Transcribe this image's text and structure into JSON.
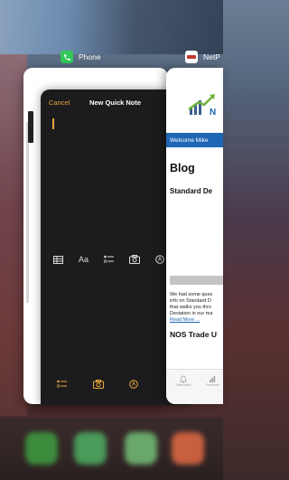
{
  "apps": [
    {
      "name": "Phone",
      "icon": "phone-icon",
      "color": "#34c759"
    },
    {
      "name": "NetP",
      "icon": "netp-app-icon",
      "color": "#ffffff"
    }
  ],
  "notes": {
    "cancel_label": "Cancel",
    "title": "New Quick Note",
    "toolbar": [
      "table-icon",
      "Aa",
      "checklist-icon",
      "camera-icon",
      "markup-icon"
    ],
    "bottom": [
      "checklist-icon",
      "camera-icon",
      "markup-icon"
    ],
    "accent": "#e8a838"
  },
  "web": {
    "welcome": "Welcome  Mike",
    "blog": "Blog",
    "standard": "Standard De",
    "body": [
      "We had some ques",
      "info on Standard D",
      "that walks you thro",
      "Deviation in our ma"
    ],
    "read_more": "Read More ...",
    "nos": "NOS Trade U",
    "tabs": [
      "Trade Alert",
      "Performa"
    ],
    "accent": "#1f66b5"
  }
}
